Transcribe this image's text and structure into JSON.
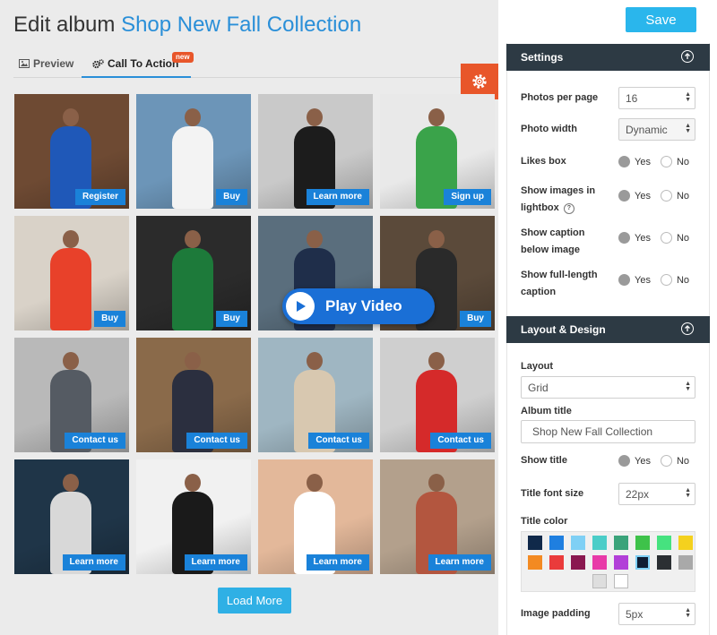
{
  "header": {
    "title_prefix": "Edit album",
    "album_name": "Shop New Fall Collection"
  },
  "tabs": [
    {
      "label": "Preview",
      "icon": "image-icon",
      "active": false
    },
    {
      "label": "Call To Action",
      "icon": "gears-icon",
      "active": true,
      "badge": "new"
    }
  ],
  "grid": {
    "photos": [
      {
        "cta": "Register",
        "bg": "#6e4a33",
        "fig": "#1f58b8"
      },
      {
        "cta": "Buy",
        "bg": "#6c95b8",
        "fig": "#f3f3f3"
      },
      {
        "cta": "Learn more",
        "bg": "#c9c9c9",
        "fig": "#1c1c1c"
      },
      {
        "cta": "Sign up",
        "bg": "#e9e9e9",
        "fig": "#3aa34a"
      },
      {
        "cta": "Buy",
        "bg": "#d9d2c8",
        "fig": "#e8412a"
      },
      {
        "cta": "Buy",
        "bg": "#2b2b2b",
        "fig": "#1d7a3a"
      },
      {
        "cta": "",
        "bg": "#5a6e7d",
        "fig": "#1f2e4a"
      },
      {
        "cta": "Buy",
        "bg": "#5b4a3a",
        "fig": "#2a2a2a"
      },
      {
        "cta": "Contact us",
        "bg": "#b9b9b9",
        "fig": "#555b63"
      },
      {
        "cta": "Contact us",
        "bg": "#8a6a4a",
        "fig": "#2b2f3f"
      },
      {
        "cta": "Contact us",
        "bg": "#9fb6c2",
        "fig": "#d8c8b0"
      },
      {
        "cta": "Contact us",
        "bg": "#cfcfcf",
        "fig": "#d52a2a"
      },
      {
        "cta": "Learn more",
        "bg": "#1f3548",
        "fig": "#d8d8d8"
      },
      {
        "cta": "Learn more",
        "bg": "#f1f1f1",
        "fig": "#1a1a1a"
      },
      {
        "cta": "Learn more",
        "bg": "#e3b89a",
        "fig": "#ffffff"
      },
      {
        "cta": "Learn more",
        "bg": "#b3a08c",
        "fig": "#b3563f"
      }
    ],
    "play_video": "Play Video",
    "load_more": "Load More"
  },
  "panel": {
    "save": "Save",
    "settings": {
      "title": "Settings",
      "photos_per_page": {
        "label": "Photos per page",
        "value": "16"
      },
      "photo_width": {
        "label": "Photo width",
        "value": "Dynamic"
      },
      "likes_box": {
        "label": "Likes box",
        "selected": "Yes"
      },
      "lightbox": {
        "label": "Show images in lightbox",
        "selected": "Yes"
      },
      "caption": {
        "label": "Show caption below image",
        "selected": "Yes"
      },
      "full_caption": {
        "label": "Show full-length caption",
        "selected": "Yes"
      },
      "yes": "Yes",
      "no": "No"
    },
    "layout": {
      "title": "Layout & Design",
      "layout": {
        "label": "Layout",
        "value": "Grid"
      },
      "album_title": {
        "label": "Album title",
        "value": "Shop New Fall Collection"
      },
      "show_title": {
        "label": "Show title",
        "selected": "Yes"
      },
      "title_font_size": {
        "label": "Title font size",
        "value": "22px"
      },
      "title_color": {
        "label": "Title color",
        "swatches": [
          "#10294a",
          "#1f7fe0",
          "#7fd0f5",
          "#4bcdc8",
          "#3aa37a",
          "#3ec24a",
          "#46e27f",
          "#f4d11e",
          "#f38a22",
          "#ea3b3b",
          "#8a1850",
          "#e83aa8",
          "#b23fd8",
          "#0f1d33",
          "#2b2f33",
          "#a9a9a9",
          "#dedede",
          "#ffffff"
        ],
        "selected_index": 13
      },
      "image_padding": {
        "label": "Image padding",
        "value": "5px"
      }
    }
  }
}
